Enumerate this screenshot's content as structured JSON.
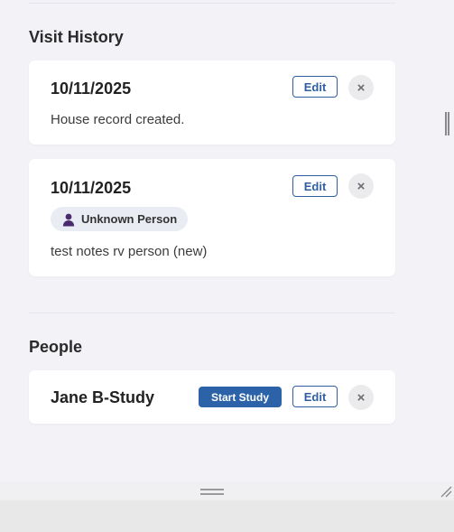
{
  "visit_history": {
    "title": "Visit History",
    "entries": [
      {
        "date": "10/11/2025",
        "edit_label": "Edit",
        "close_label": "×",
        "note": "House record created."
      },
      {
        "date": "10/11/2025",
        "edit_label": "Edit",
        "close_label": "×",
        "person_badge": "Unknown Person",
        "note": "test notes rv person (new)"
      }
    ]
  },
  "people": {
    "title": "People",
    "items": [
      {
        "name": "Jane B-Study",
        "start_study_label": "Start Study",
        "edit_label": "Edit",
        "close_label": "×"
      }
    ]
  },
  "colors": {
    "accent": "#2f5fa0",
    "primary_button": "#2c63a8",
    "badge_icon": "#4a2a6e",
    "background": "#f3f2f7"
  }
}
